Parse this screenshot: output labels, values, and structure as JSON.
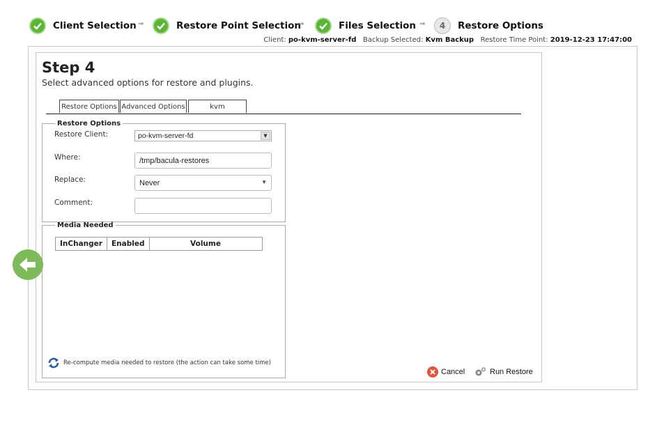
{
  "wizard": {
    "steps": [
      {
        "label": "Client Selection",
        "status": "done"
      },
      {
        "label": "Restore Point Selection",
        "status": "done"
      },
      {
        "label": "Files Selection",
        "status": "done"
      },
      {
        "label": "Restore Options",
        "status": "current",
        "number": "4"
      }
    ],
    "arrow": "⇒"
  },
  "info": {
    "client_label": "Client:",
    "client_value": "po-kvm-server-fd",
    "backup_label": "Backup Selected:",
    "backup_value": "Kvm Backup",
    "time_label": "Restore Time Point:",
    "time_value": "2019-12-23 17:47:00"
  },
  "page": {
    "title": "Step 4",
    "subtitle": "Select advanced options for restore and plugins."
  },
  "tabs": [
    "Restore Options",
    "Advanced Options",
    "kvm"
  ],
  "restore_options": {
    "legend": "Restore Options",
    "client_label": "Restore Client:",
    "client_value": "po-kvm-server-fd",
    "where_label": "Where:",
    "where_value": "/tmp/bacula-restores",
    "replace_label": "Replace:",
    "replace_value": "Never",
    "comment_label": "Comment:",
    "comment_value": ""
  },
  "media_needed": {
    "legend": "Media Needed",
    "columns": [
      "InChanger",
      "Enabled",
      "Volume"
    ],
    "recompute_label": "Re-compute media needed to restore (the action can take some time)"
  },
  "actions": {
    "cancel_label": "Cancel",
    "run_label": "Run Restore"
  },
  "colors": {
    "done_green": "#5cb536",
    "back_green": "#7dba5a",
    "cancel_red": "#e2533f"
  }
}
